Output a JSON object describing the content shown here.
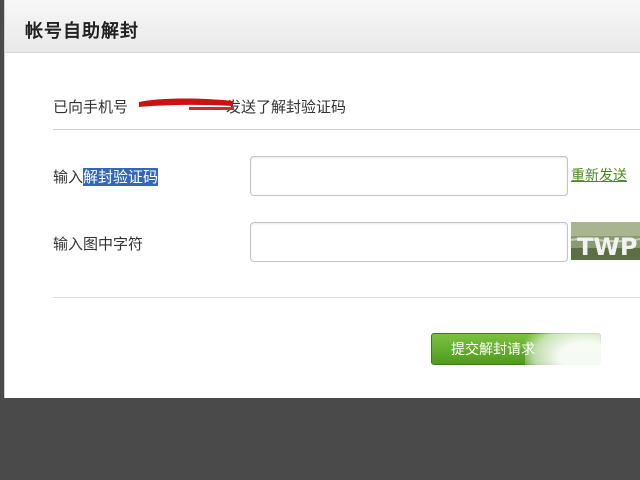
{
  "dialog": {
    "title": "帐号自助解封",
    "info_prefix": "已向手机号",
    "info_suffix": "发送了解封验证码"
  },
  "form": {
    "code_label_prefix": "输入",
    "code_label_highlight": "解封验证码",
    "code_value": "",
    "resend_label": "重新发送",
    "captcha_label": "输入图中字符",
    "captcha_value": "",
    "captcha_image_text": "TWP"
  },
  "actions": {
    "submit_label": "提交解封请求"
  },
  "colors": {
    "accent_green": "#5aa726",
    "link_green": "#4d8a1d",
    "selection_blue": "#3366bb",
    "redaction_red": "#cc1111"
  }
}
